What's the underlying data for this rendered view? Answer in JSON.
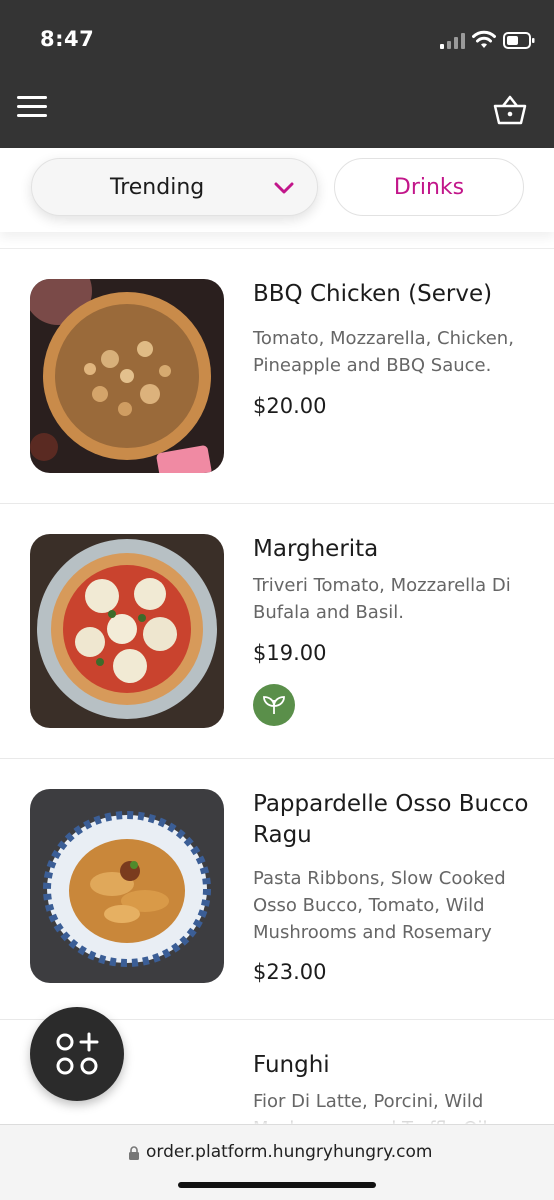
{
  "status_bar": {
    "time": "8:47"
  },
  "categories": {
    "selected": "Trending",
    "other": "Drinks"
  },
  "items": [
    {
      "name": "BBQ Chicken (Serve)",
      "description": "Tomato, Mozzarella, Chicken, Pineapple and BBQ Sauce.",
      "price": "$20.00"
    },
    {
      "name": "Margherita",
      "description": "Triveri Tomato, Mozzarella Di Bufala and Basil.",
      "price": "$19.00",
      "badge": "leaf-icon"
    },
    {
      "name": "Pappardelle Osso Bucco Ragu",
      "description": "Pasta Ribbons, Slow Cooked Osso Bucco, Tomato, Wild Mushrooms and Rosemary",
      "price": "$23.00"
    },
    {
      "name": "Funghi",
      "description": "Fior Di Latte, Porcini, Wild Mushrooms and Truffle Oil"
    }
  ],
  "url_bar": {
    "url": "order.platform.hungryhungry.com"
  },
  "colors": {
    "accent": "#c2168a",
    "header": "#343434",
    "veg": "#5a8f4a"
  }
}
